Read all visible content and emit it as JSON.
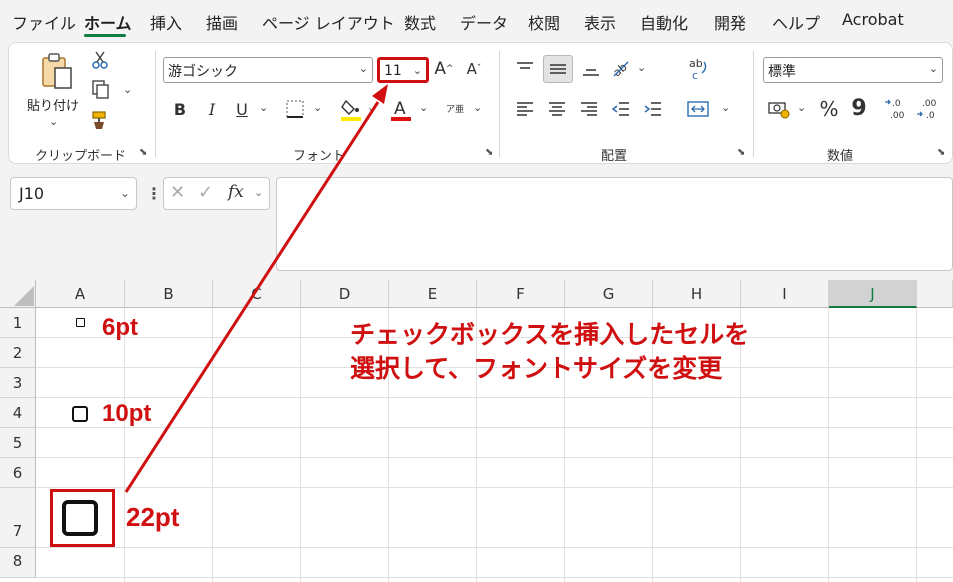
{
  "menu": {
    "tabs": [
      "ファイル",
      "ホーム",
      "挿入",
      "描画",
      "ページ レイアウト",
      "数式",
      "データ",
      "校閲",
      "表示",
      "自動化",
      "開発",
      "ヘルプ",
      "Acrobat"
    ]
  },
  "ribbon": {
    "clipboard": {
      "paste_label": "貼り付け",
      "group_label": "クリップボード"
    },
    "font": {
      "font_name": "游ゴシック",
      "font_size": "11",
      "group_label": "フォント",
      "bold": "B",
      "italic": "I",
      "underline": "U",
      "phonetic": "ア亜"
    },
    "alignment": {
      "group_label": "配置"
    },
    "number": {
      "format": "標準",
      "percent": "%",
      "comma": "9",
      "group_label": "数値"
    }
  },
  "formula_bar": {
    "name_box": "J10",
    "fx": "fx",
    "content": ""
  },
  "sheet": {
    "columns": [
      "A",
      "B",
      "C",
      "D",
      "E",
      "F",
      "G",
      "H",
      "I",
      "J"
    ],
    "rows": [
      "1",
      "2",
      "3",
      "4",
      "5",
      "6",
      "7",
      "8"
    ],
    "selected_column": "J"
  },
  "annotations": {
    "size_6": "6pt",
    "size_10": "10pt",
    "size_22": "22pt",
    "instruction_line1": "チェックボックスを挿入したセルを",
    "instruction_line2": "選択して、フォントサイズを変更",
    "color": "#d01010"
  }
}
